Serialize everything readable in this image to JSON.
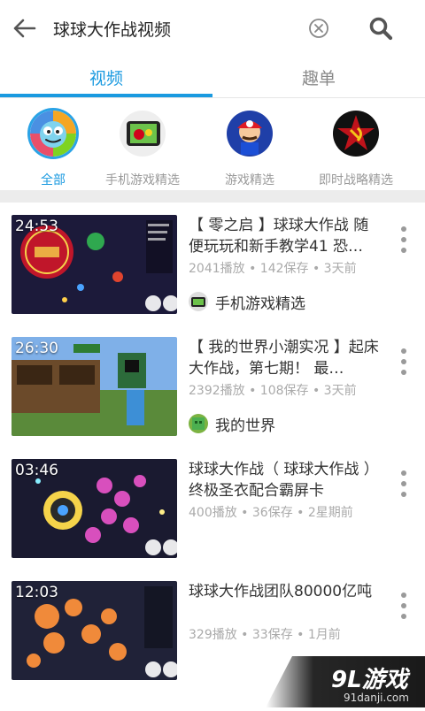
{
  "search": {
    "query": "球球大作战视频",
    "back_icon": "arrow-left-icon",
    "clear_icon": "circle-x-icon",
    "search_icon": "magnifier-icon"
  },
  "tabs": [
    {
      "label": "视频",
      "active": true
    },
    {
      "label": "趣单",
      "active": false
    }
  ],
  "categories": [
    {
      "label": "全部",
      "active": true,
      "icon": "all-category-icon"
    },
    {
      "label": "手机游戏精选",
      "active": false,
      "icon": "mobile-game-icon"
    },
    {
      "label": "游戏精选",
      "active": false,
      "icon": "mario-icon"
    },
    {
      "label": "即时战略精选",
      "active": false,
      "icon": "rts-emblem-icon"
    }
  ],
  "videos": [
    {
      "duration": "24:53",
      "title": "【 零之启 】球球大作战 随便玩玩和新手教学41 恐…",
      "meta": "2041播放 • 142保存 • 3天前",
      "channel": "手机游戏精选"
    },
    {
      "duration": "26:30",
      "title": "【 我的世界小潮实况 】起床大作战，第七期！ 最…",
      "meta": "2392播放 • 108保存 • 3天前",
      "channel": "我的世界"
    },
    {
      "duration": "03:46",
      "title": "球球大作战（ 球球大作战 ）终极圣衣配合霸屏卡",
      "meta": "400播放 • 36保存 • 2星期前",
      "channel": ""
    },
    {
      "duration": "12:03",
      "title": "球球大作战团队80000亿吨",
      "meta": "329播放 • 33保存 • 1月前",
      "channel": ""
    }
  ],
  "watermark": {
    "brand": "9L游戏",
    "url": "91danji.com"
  },
  "colors": {
    "accent": "#1a9ae0",
    "meta_text": "#aaaaaa",
    "divider": "#ececec"
  }
}
